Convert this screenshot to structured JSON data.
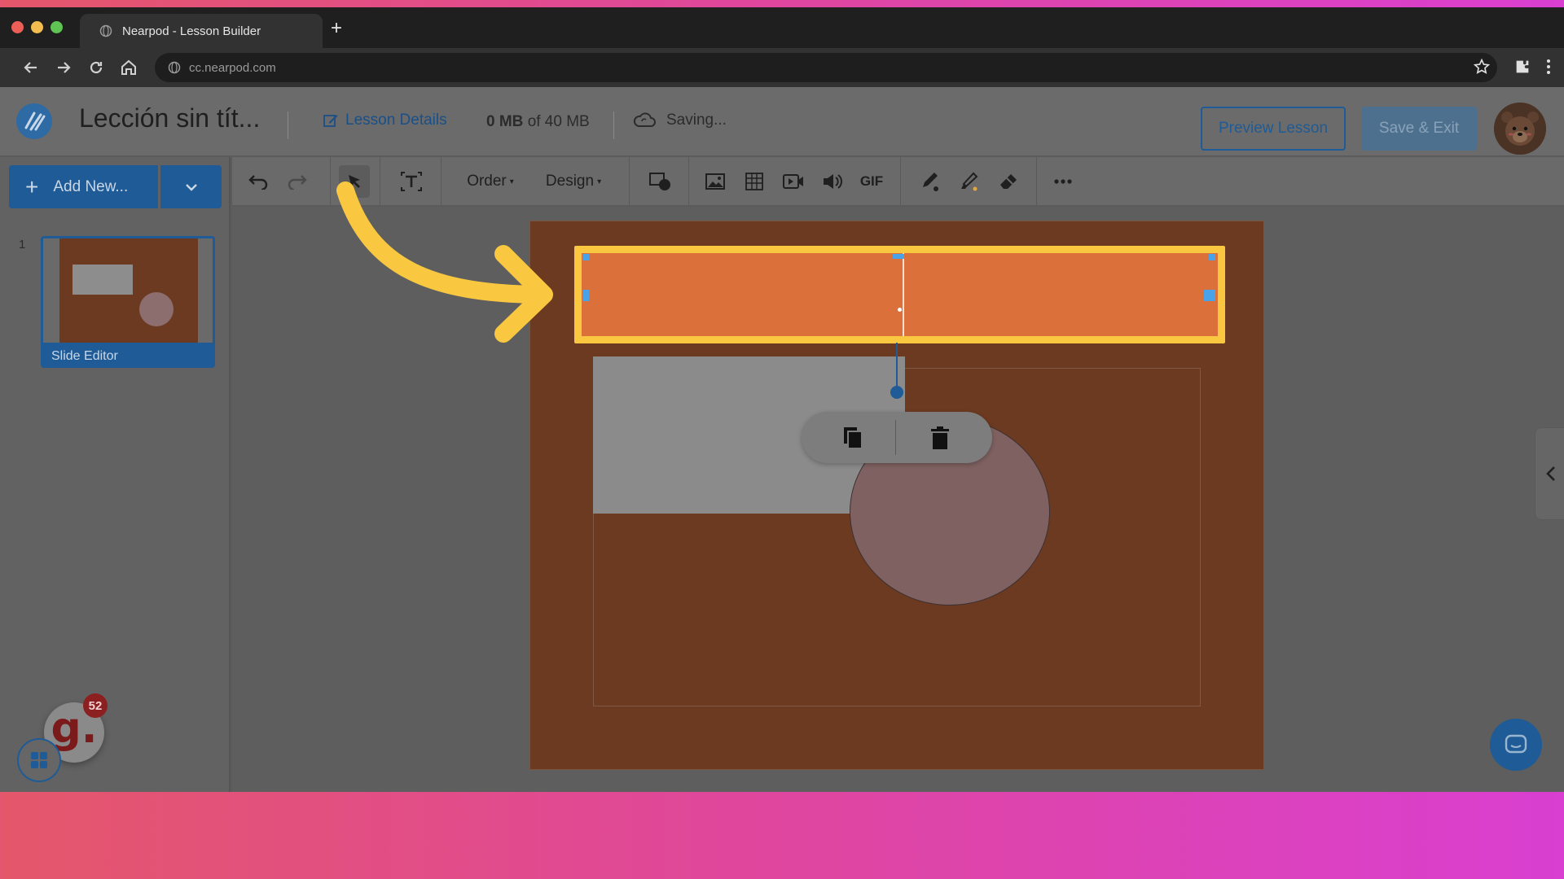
{
  "browser": {
    "tab_title": "Nearpod - Lesson Builder",
    "new_tab_symbol": "+",
    "url": "cc.nearpod.com"
  },
  "header": {
    "lesson_title": "Lección sin tít...",
    "lesson_details_label": "Lesson Details",
    "storage_used": "0 MB",
    "storage_rest": "of 40 MB",
    "saving_label": "Saving...",
    "preview_label": "Preview Lesson",
    "save_exit_label": "Save & Exit"
  },
  "sidebar": {
    "add_new_label": "Add New...",
    "slides": [
      {
        "number": "1",
        "label": "Slide Editor"
      }
    ],
    "badge_letter": "g.",
    "badge_count": "52"
  },
  "toolbar": {
    "order_label": "Order",
    "design_label": "Design",
    "gif_label": "GIF",
    "caret": "▾"
  },
  "icons": {
    "undo": "undo-icon",
    "redo": "redo-icon",
    "select": "pointer-icon",
    "text": "text-icon",
    "shapes": "shapes-icon",
    "image": "image-icon",
    "table": "table-icon",
    "video": "video-icon",
    "audio": "audio-icon",
    "pen": "pen-icon",
    "highlighter": "highlighter-icon",
    "eraser": "eraser-icon",
    "more": "more-icon",
    "copy": "copy-icon",
    "delete": "trash-icon",
    "collapse": "chevron-left-icon",
    "chat": "chat-icon",
    "apps": "apps-grid-icon"
  },
  "colors": {
    "accent": "#1e5b97",
    "highlight": "#f9c840",
    "banner": "#dc703a",
    "slide_bg": "#6b3a20"
  }
}
